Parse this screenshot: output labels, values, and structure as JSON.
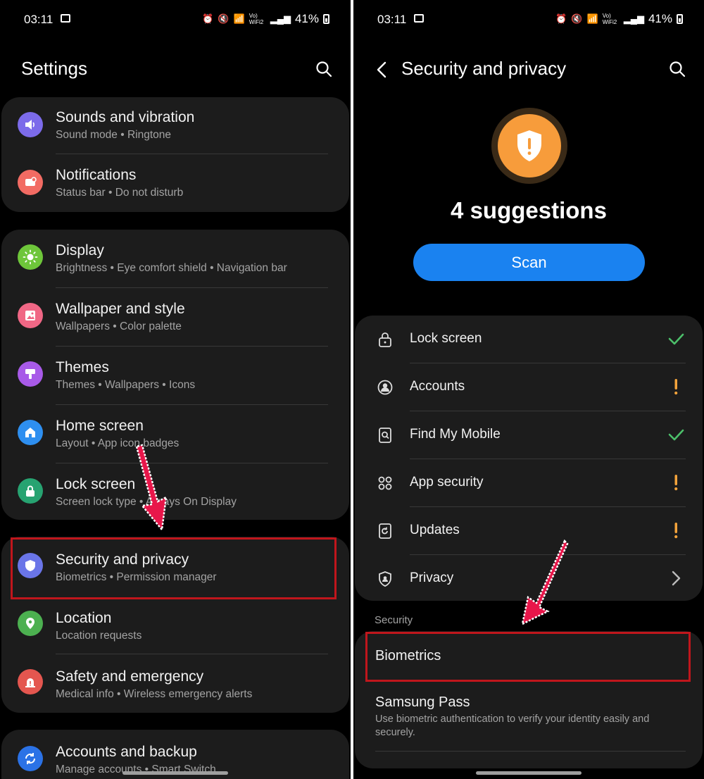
{
  "left": {
    "status": {
      "time": "03:11",
      "battery": "41%",
      "net": "Vo) WiFi2"
    },
    "title": "Settings",
    "groups": [
      {
        "items": [
          {
            "title": "Sounds and vibration",
            "subtitle": "Sound mode  •  Ringtone",
            "icon": "speaker-icon",
            "color": "#7c6bea"
          },
          {
            "title": "Notifications",
            "subtitle": "Status bar  •  Do not disturb",
            "icon": "notification-icon",
            "color": "#f26b63"
          }
        ]
      },
      {
        "items": [
          {
            "title": "Display",
            "subtitle": "Brightness  •  Eye comfort shield  •  Navigation bar",
            "icon": "sun-icon",
            "color": "#6ec63a"
          },
          {
            "title": "Wallpaper and style",
            "subtitle": "Wallpapers  •  Color palette",
            "icon": "picture-icon",
            "color": "#f06785"
          },
          {
            "title": "Themes",
            "subtitle": "Themes  •  Wallpapers  •  Icons",
            "icon": "brush-icon",
            "color": "#a85ae8"
          },
          {
            "title": "Home screen",
            "subtitle": "Layout  •  App icon badges",
            "icon": "home-icon",
            "color": "#2e8ff0"
          },
          {
            "title": "Lock screen",
            "subtitle": "Screen lock type  •  Always On Display",
            "icon": "lock-icon",
            "color": "#27a371"
          }
        ]
      },
      {
        "items": [
          {
            "title": "Security and privacy",
            "subtitle": "Biometrics  •  Permission manager",
            "icon": "shield-icon",
            "color": "#6a75e8"
          },
          {
            "title": "Location",
            "subtitle": "Location requests",
            "icon": "location-pin-icon",
            "color": "#4cb050"
          },
          {
            "title": "Safety and emergency",
            "subtitle": "Medical info  •  Wireless emergency alerts",
            "icon": "alert-icon",
            "color": "#e4564f"
          }
        ]
      },
      {
        "items": [
          {
            "title": "Accounts and backup",
            "subtitle": "Manage accounts  •  Smart Switch",
            "icon": "sync-icon",
            "color": "#2b72e6"
          }
        ]
      }
    ]
  },
  "right": {
    "status": {
      "time": "03:11",
      "battery": "41%",
      "net": "Vo) WiFi2"
    },
    "title": "Security and privacy",
    "suggestions": "4 suggestions",
    "scan_label": "Scan",
    "items": [
      {
        "label": "Lock screen",
        "icon": "lock-icon",
        "status": "ok"
      },
      {
        "label": "Accounts",
        "icon": "account-icon",
        "status": "warning"
      },
      {
        "label": "Find My Mobile",
        "icon": "find-mobile-icon",
        "status": "ok"
      },
      {
        "label": "App security",
        "icon": "apps-grid-icon",
        "status": "warning"
      },
      {
        "label": "Updates",
        "icon": "update-icon",
        "status": "warning"
      },
      {
        "label": "Privacy",
        "icon": "privacy-shield-icon",
        "status": "chevron"
      }
    ],
    "section_label": "Security",
    "biometrics": "Biometrics",
    "samsung_pass": {
      "title": "Samsung Pass",
      "subtitle_line1": "Use biometric authentication to verify your identity easily and",
      "subtitle_line2": "securely."
    }
  },
  "colors": {
    "ok": "#4cbf6a",
    "warning": "#f3a33b",
    "highlight": "#c0161c",
    "scan": "#1a82f0"
  }
}
